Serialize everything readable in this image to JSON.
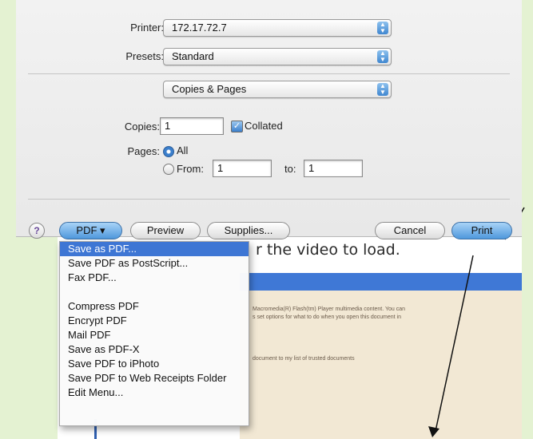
{
  "printer": {
    "label": "Printer:",
    "value": "172.17.72.7"
  },
  "presets": {
    "label": "Presets:",
    "value": "Standard"
  },
  "section": {
    "value": "Copies & Pages"
  },
  "copies": {
    "label": "Copies:",
    "value": "1",
    "collated_label": "Collated",
    "collated": true
  },
  "pages": {
    "label": "Pages:",
    "all_label": "All",
    "from_label": "From:",
    "from_value": "1",
    "to_label": "to:",
    "to_value": "1",
    "selected": "All"
  },
  "buttons": {
    "help": "?",
    "pdf": "PDF ▾",
    "preview": "Preview",
    "supplies": "Supplies...",
    "cancel": "Cancel",
    "print": "Print"
  },
  "pdf_menu": {
    "items": [
      {
        "label": "Save as PDF...",
        "selected": true
      },
      {
        "label": "Save PDF as PostScript..."
      },
      {
        "label": "Fax PDF..."
      },
      {
        "label": "Compress PDF"
      },
      {
        "label": "Encrypt PDF"
      },
      {
        "label": "Mail PDF"
      },
      {
        "label": "Save as PDF-X"
      },
      {
        "label": "Save PDF to iPhoto"
      },
      {
        "label": "Save PDF to Web Receipts Folder"
      },
      {
        "label": "Edit Menu..."
      }
    ]
  },
  "background": {
    "video_text": "r the video to load.",
    "fine_1": "Macromedia(R) Flash(tm) Player multimedia content. You can",
    "fine_2": "s set options for what to do when you open this document in",
    "fine_3": "document to my list of trusted documents"
  },
  "colors": {
    "accent": "#3e76d4",
    "frame": "#e4f2d2"
  }
}
